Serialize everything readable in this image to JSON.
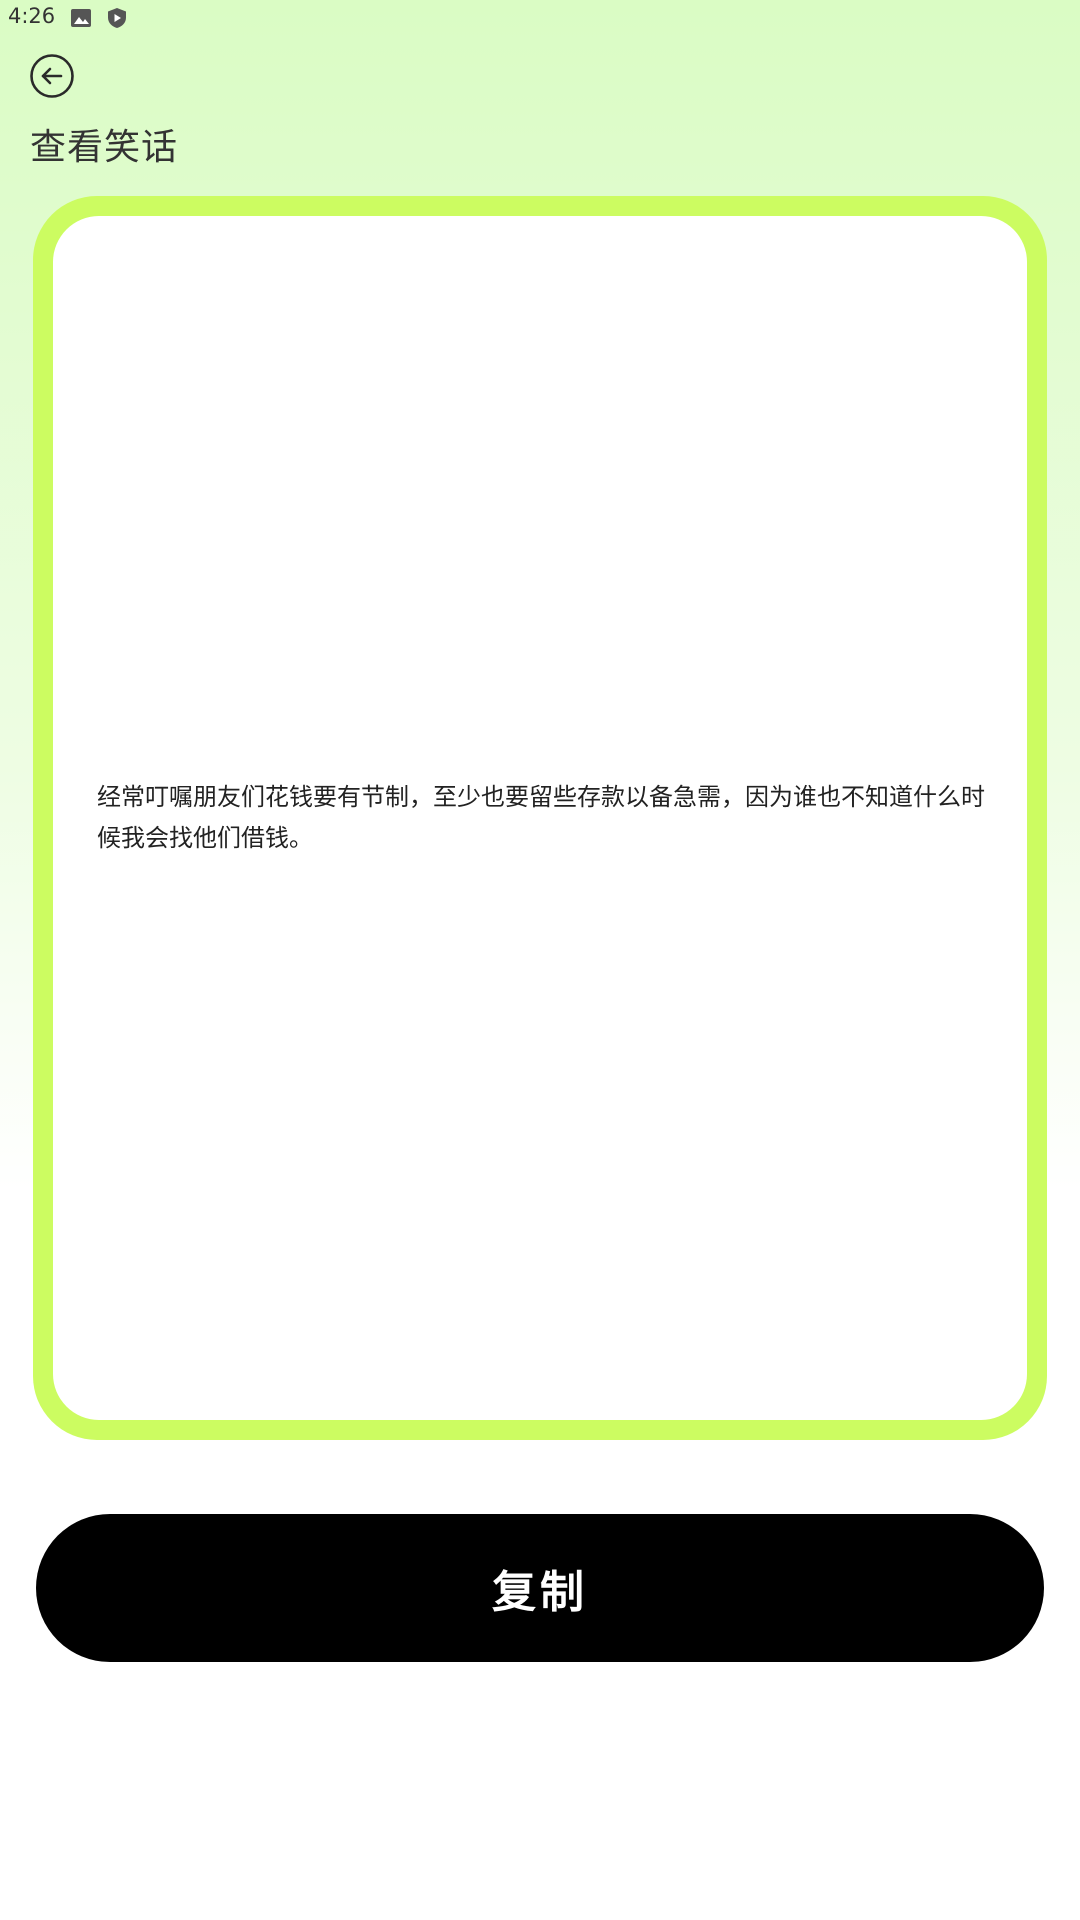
{
  "status_bar": {
    "time": "4:26",
    "icons": [
      "image-icon",
      "shield-icon"
    ]
  },
  "header": {
    "back_icon": "arrow-left-circle-icon",
    "title": "查看笑话"
  },
  "card": {
    "joke": "经常叮嘱朋友们花钱要有节制，至少也要留些存款以备急需，因为谁也不知道什么时候我会找他们借钱。"
  },
  "actions": {
    "copy_label": "复制"
  },
  "colors": {
    "card_border": "#ccfc61",
    "bg_top": "#dafcc4",
    "button_bg": "#000000",
    "button_text": "#ffffff"
  }
}
